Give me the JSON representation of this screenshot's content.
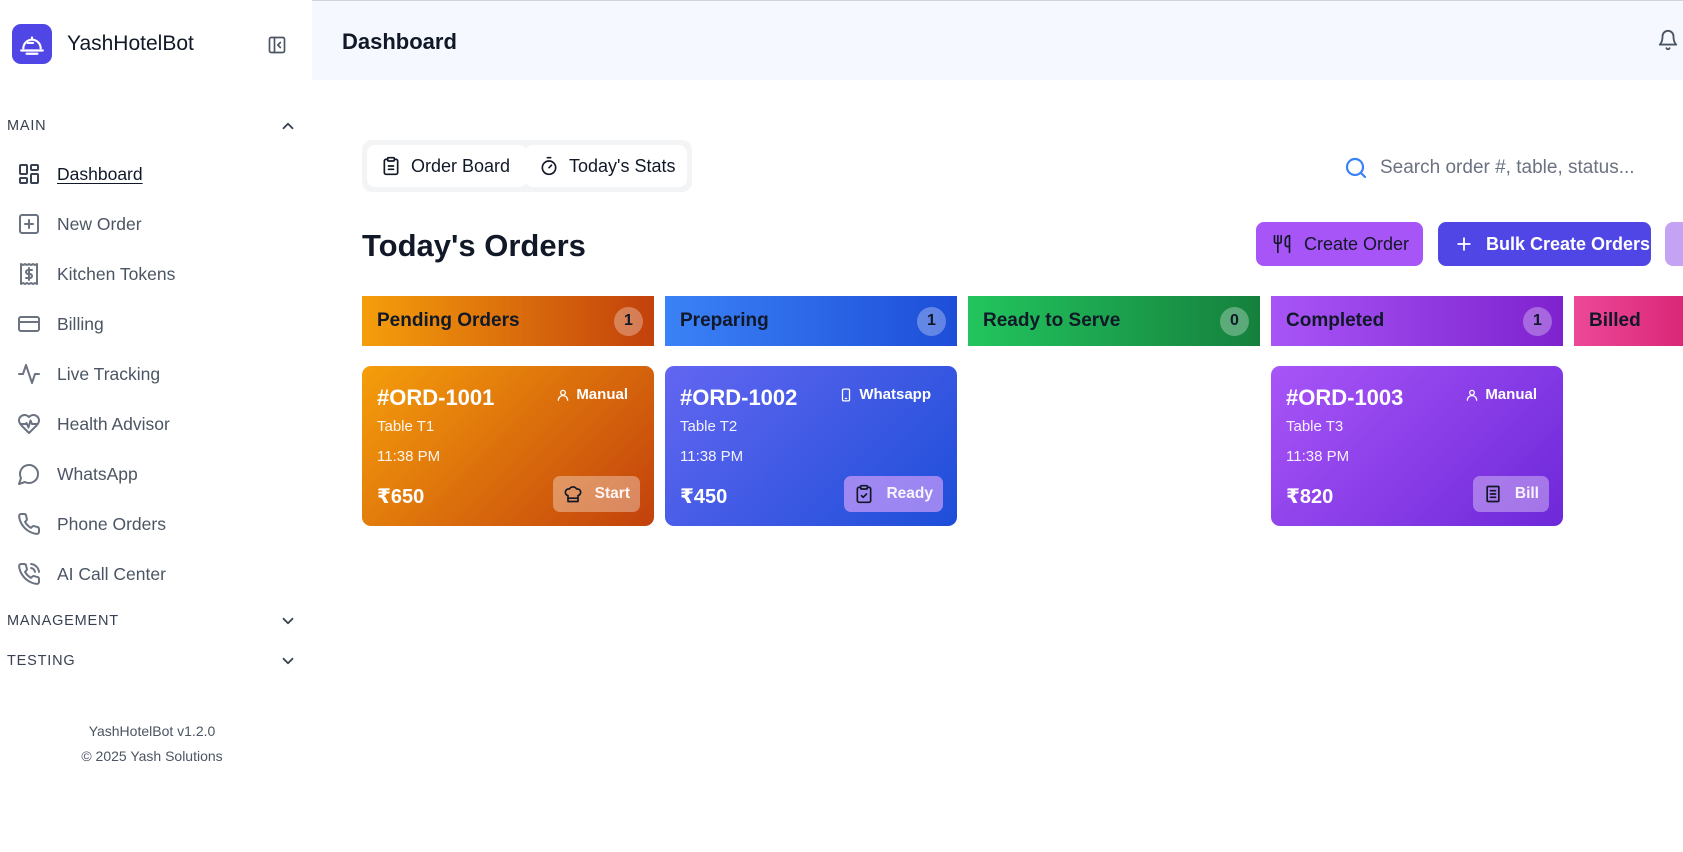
{
  "app": {
    "name": "YashHotelBot"
  },
  "header": {
    "title": "Dashboard"
  },
  "sidebar": {
    "sections": [
      {
        "label": "MAIN",
        "expanded": true
      },
      {
        "label": "MANAGEMENT",
        "expanded": false
      },
      {
        "label": "TESTING",
        "expanded": false
      }
    ],
    "items": [
      {
        "label": "Dashboard",
        "icon": "dashboard-grid-icon",
        "active": true
      },
      {
        "label": "New Order",
        "icon": "plus-square-icon"
      },
      {
        "label": "Kitchen Tokens",
        "icon": "receipt-dollar-icon"
      },
      {
        "label": "Billing",
        "icon": "credit-card-icon"
      },
      {
        "label": "Live Tracking",
        "icon": "activity-icon"
      },
      {
        "label": "Health Advisor",
        "icon": "heart-pulse-icon"
      },
      {
        "label": "WhatsApp",
        "icon": "message-circle-icon"
      },
      {
        "label": "Phone Orders",
        "icon": "phone-icon"
      },
      {
        "label": "AI Call Center",
        "icon": "phone-call-icon"
      }
    ],
    "footer": {
      "version": "YashHotelBot v1.2.0",
      "copyright": "© 2025 Yash Solutions"
    }
  },
  "tabs": [
    {
      "label": "Order Board",
      "icon": "clipboard-icon"
    },
    {
      "label": "Today's Stats",
      "icon": "timer-icon"
    }
  ],
  "search": {
    "placeholder": "Search order #, table, status..."
  },
  "page": {
    "title": "Today's Orders"
  },
  "actions": {
    "create_order": "Create Order",
    "bulk_create": "Bulk Create Orders"
  },
  "columns": [
    {
      "title": "Pending Orders",
      "count": "1",
      "color_from": "#f59e0b",
      "color_to": "#c2410c"
    },
    {
      "title": "Preparing",
      "count": "1",
      "color_from": "#3b82f6",
      "color_to": "#1d4ed8"
    },
    {
      "title": "Ready to Serve",
      "count": "0",
      "color_from": "#22c55e",
      "color_to": "#15803d"
    },
    {
      "title": "Completed",
      "count": "1",
      "color_from": "#a855f7",
      "color_to": "#7e22ce"
    },
    {
      "title": "Billed",
      "count": "",
      "color_from": "#ec4899",
      "color_to": "#db2777"
    }
  ],
  "orders": [
    {
      "id": "#ORD-1001",
      "source": "Manual",
      "table": "Table T1",
      "time": "11:38 PM",
      "amount": "₹650",
      "action": "Start"
    },
    {
      "id": "#ORD-1002",
      "source": "Whatsapp",
      "table": "Table T2",
      "time": "11:38 PM",
      "amount": "₹450",
      "action": "Ready"
    },
    {
      "id": "#ORD-1003",
      "source": "Manual",
      "table": "Table T3",
      "time": "11:38 PM",
      "amount": "₹820",
      "action": "Bill"
    }
  ]
}
